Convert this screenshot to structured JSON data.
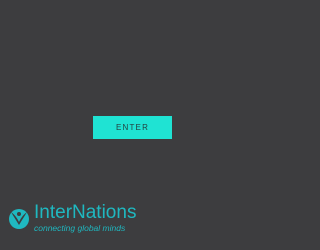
{
  "colors": {
    "background": "#3d3d3f",
    "button_bg": "#1fe3d3",
    "button_text": "#24403f",
    "brand": "#1fb8c0"
  },
  "main": {
    "enter_label": "ENTER"
  },
  "logo": {
    "icon": "bird-icon",
    "name": "InterNations",
    "tagline": "connecting global minds"
  }
}
